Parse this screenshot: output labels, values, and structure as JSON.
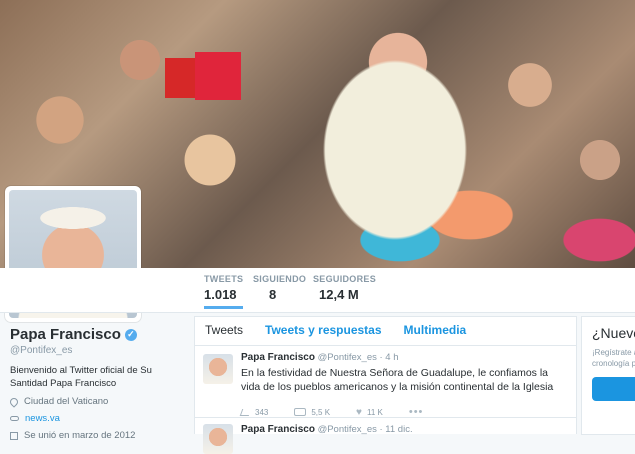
{
  "profile": {
    "name": "Papa Francisco",
    "handle": "@Pontifex_es",
    "bio": "Bienvenido al Twitter oficial de Su Santidad Papa Francisco",
    "location": "Ciudad del Vaticano",
    "website": "news.va",
    "joined": "Se unió en marzo de 2012"
  },
  "stats": [
    {
      "label": "TWEETS",
      "value": "1.018"
    },
    {
      "label": "SIGUIENDO",
      "value": "8"
    },
    {
      "label": "SEGUIDORES",
      "value": "12,4 M"
    }
  ],
  "tabs": [
    "Tweets",
    "Tweets y respuestas",
    "Multimedia"
  ],
  "tweets": [
    {
      "name": "Papa Francisco",
      "handle": "@Pontifex_es",
      "time": "· 4 h",
      "text": "En la festividad de Nuestra Señora de Guadalupe, le confiamos la vida de los pueblos americanos y la misión continental de la Iglesia",
      "replies": "343",
      "retweets": "5,5 K",
      "likes": "11 K",
      "more": "•••"
    },
    {
      "name": "Papa Francisco",
      "handle": "@Pontifex_es",
      "time": "· 11 dic."
    }
  ],
  "sidebar": {
    "title": "¿Nuevo en Twitter?",
    "line1": "¡Regístrate ahora para obtener",
    "line2": "cronología personalizada!"
  }
}
